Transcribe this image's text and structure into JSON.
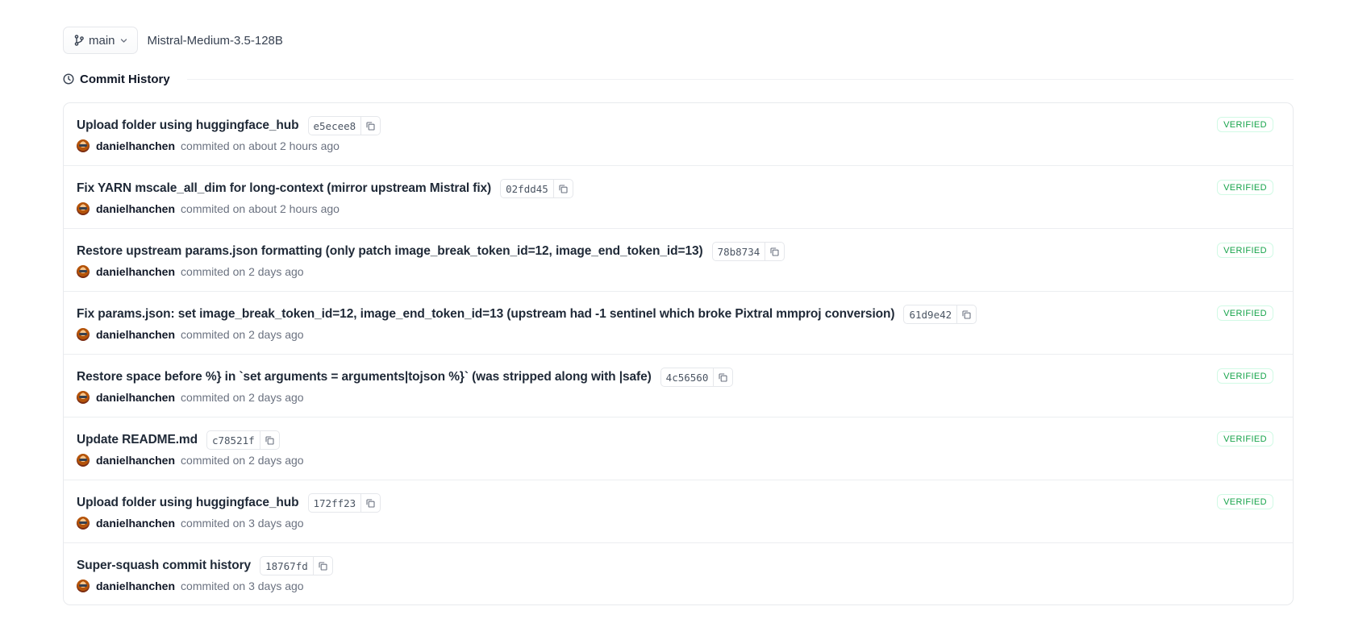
{
  "header": {
    "branch_label": "main",
    "repo_name": "Mistral-Medium-3.5-128B"
  },
  "history": {
    "title": "Commit History"
  },
  "commits": [
    {
      "message": "Upload folder using huggingface_hub",
      "sha": "e5ecee8",
      "author": "danielhanchen",
      "when": "commited on about 2 hours ago",
      "badge": "VERIFIED"
    },
    {
      "message": "Fix YARN mscale_all_dim for long-context (mirror upstream Mistral fix)",
      "sha": "02fdd45",
      "author": "danielhanchen",
      "when": "commited on about 2 hours ago",
      "badge": "VERIFIED"
    },
    {
      "message": "Restore upstream params.json formatting (only patch image_break_token_id=12, image_end_token_id=13)",
      "sha": "78b8734",
      "author": "danielhanchen",
      "when": "commited on 2 days ago",
      "badge": "VERIFIED"
    },
    {
      "message": "Fix params.json: set image_break_token_id=12, image_end_token_id=13 (upstream had -1 sentinel which broke Pixtral mmproj conversion)",
      "sha": "61d9e42",
      "author": "danielhanchen",
      "when": "commited on 2 days ago",
      "badge": "VERIFIED"
    },
    {
      "message": "Restore space before %} in `set arguments = arguments|tojson %}` (was stripped along with |safe)",
      "sha": "4c56560",
      "author": "danielhanchen",
      "when": "commited on 2 days ago",
      "badge": "VERIFIED"
    },
    {
      "message": "Update README.md",
      "sha": "c78521f",
      "author": "danielhanchen",
      "when": "commited on 2 days ago",
      "badge": "VERIFIED"
    },
    {
      "message": "Upload folder using huggingface_hub",
      "sha": "172ff23",
      "author": "danielhanchen",
      "when": "commited on 3 days ago",
      "badge": "VERIFIED"
    },
    {
      "message": "Super-squash commit history",
      "sha": "18767fd",
      "author": "danielhanchen",
      "when": "commited on 3 days ago",
      "badge": ""
    }
  ],
  "icons": {
    "branch": "git-branch-icon",
    "chevron": "chevron-down-icon",
    "clock": "clock-icon",
    "copy": "copy-icon"
  },
  "colors": {
    "verified": "#16a34a",
    "border": "#e5e7eb"
  }
}
